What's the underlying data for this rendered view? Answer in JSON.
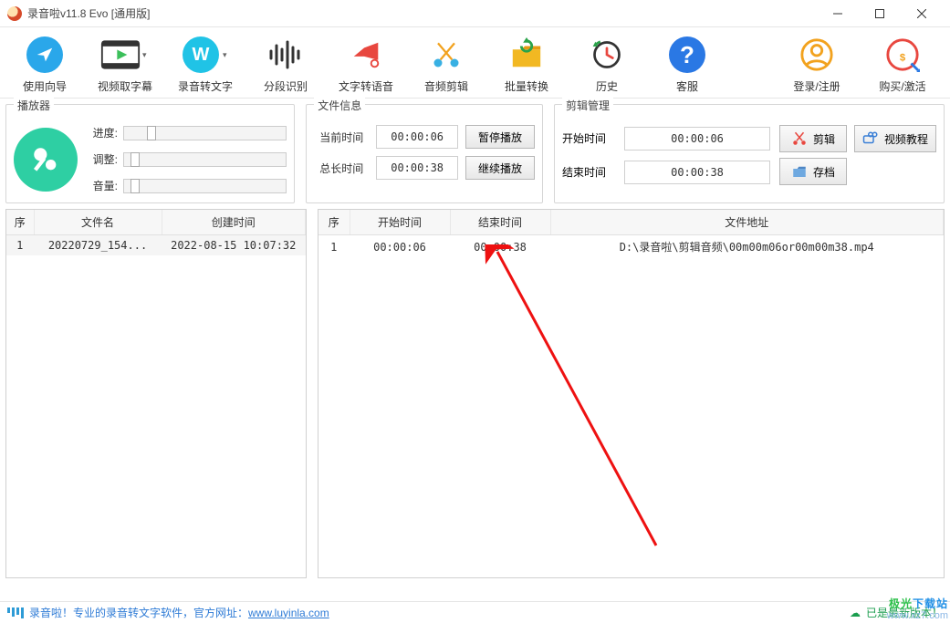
{
  "window": {
    "title": "录音啦v11.8 Evo  [通用版]"
  },
  "toolbar": {
    "guide": "使用向导",
    "subtitle": "视频取字幕",
    "rec2text": "录音转文字",
    "segment": "分段识别",
    "tts": "文字转语音",
    "clip": "音频剪辑",
    "batch": "批量转换",
    "history": "历史",
    "support": "客服",
    "login": "登录/注册",
    "buy": "购买/激活"
  },
  "player": {
    "legend": "播放器",
    "progress": "进度:",
    "speed": "调整:",
    "volume": "音量:"
  },
  "fileinfo": {
    "legend": "文件信息",
    "cur_label": "当前时间",
    "cur_value": "00:00:06",
    "total_label": "总长时间",
    "total_value": "00:00:38",
    "pause": "暂停播放",
    "resume": "继续播放"
  },
  "clipmgr": {
    "legend": "剪辑管理",
    "start_label": "开始时间",
    "start_value": "00:00:06",
    "end_label": "结束时间",
    "end_value": "00:00:38",
    "cut": "剪辑",
    "archive": "存档",
    "tutorial": "视频教程"
  },
  "left_table": {
    "headers": {
      "seq": "序",
      "name": "文件名",
      "ctime": "创建时间"
    },
    "rows": [
      {
        "seq": "1",
        "name": "20220729_154...",
        "ctime": "2022-08-15 10:07:32"
      }
    ]
  },
  "right_table": {
    "headers": {
      "seq": "序",
      "start": "开始时间",
      "end": "结束时间",
      "path": "文件地址"
    },
    "rows": [
      {
        "seq": "1",
        "start": "00:00:06",
        "end": "00:00:38",
        "path": "D:\\录音啦\\剪辑音频\\00m00m06or00m00m38.mp4"
      }
    ]
  },
  "status": {
    "text_prefix": "录音啦！专业的录音转文字软件，官方网址：",
    "url": "www.luyinla.com",
    "latest": "已是最新版本！"
  },
  "watermark": {
    "l1a": "极光",
    "l1b": "下载站",
    "l2": "www.xz7.com"
  }
}
